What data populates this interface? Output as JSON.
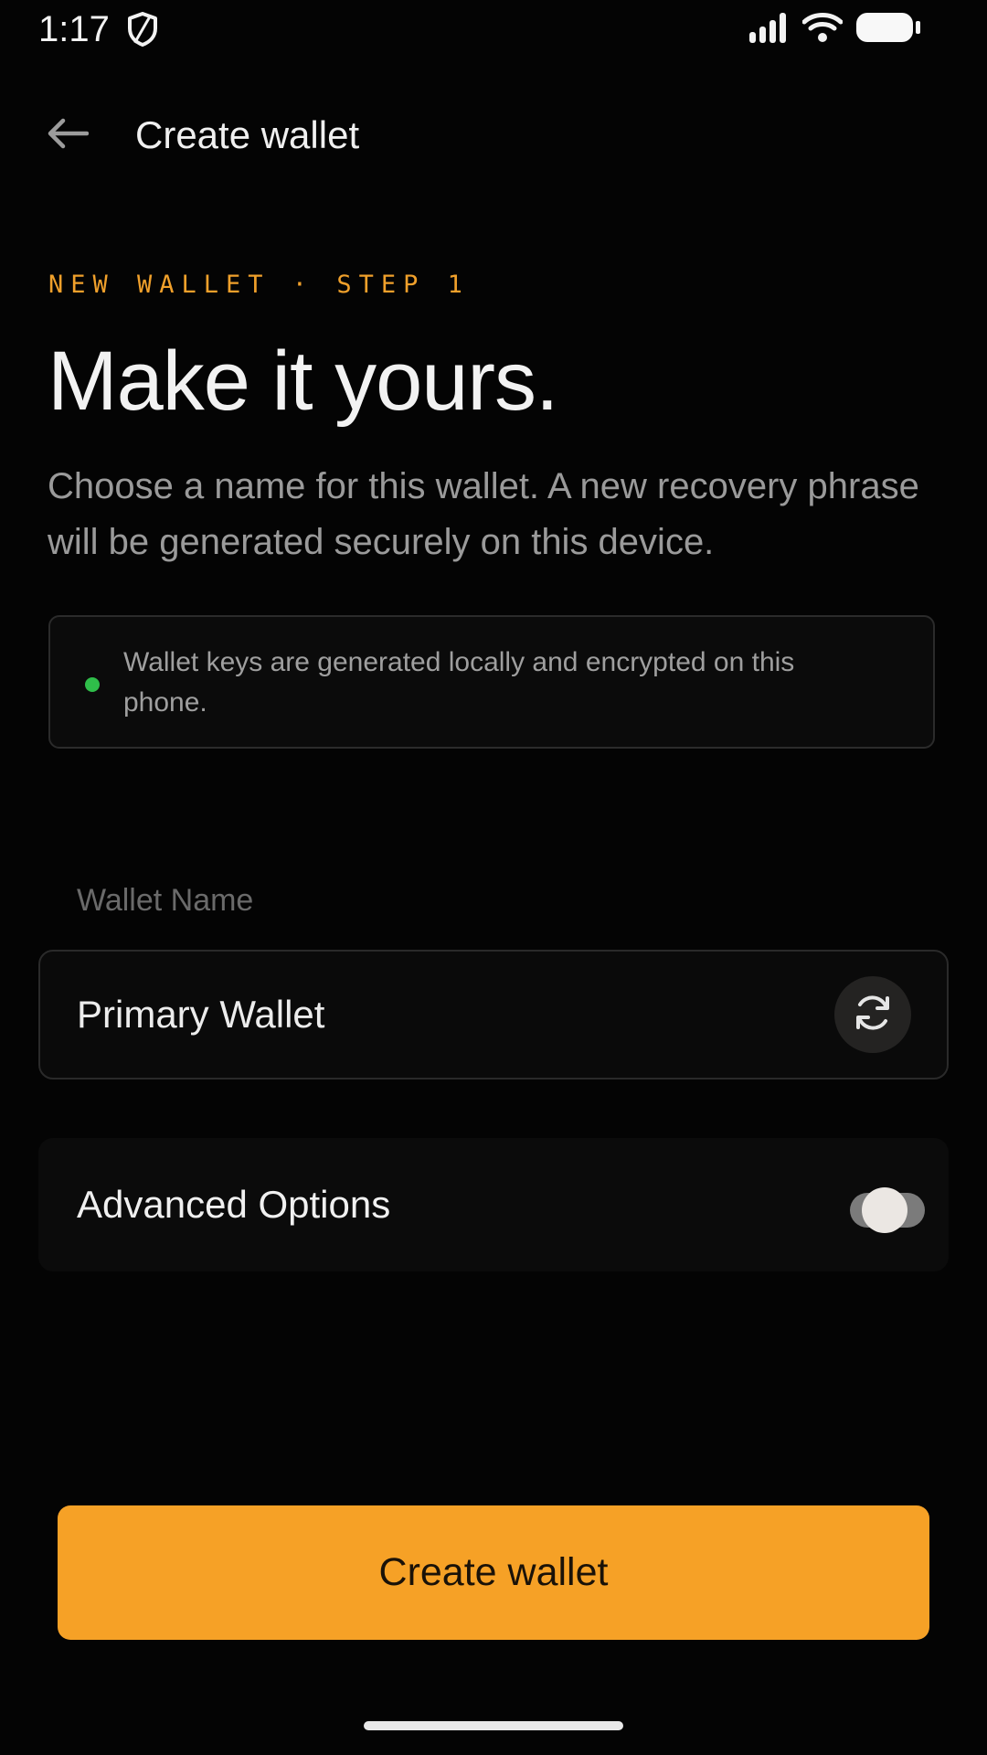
{
  "status_bar": {
    "time": "1:17",
    "icons": [
      "shield-icon",
      "signal-icon",
      "wifi-icon",
      "battery-icon"
    ]
  },
  "app_bar": {
    "back_icon": "arrow-left-icon",
    "title": "Create wallet"
  },
  "intro": {
    "eyebrow": "NEW WALLET · STEP 1",
    "headline": "Make it yours.",
    "subtext": "Choose a name for this wallet. A new recovery phrase will be generated securely on this device."
  },
  "notice": {
    "text": "Wallet keys are generated locally and encrypted on this phone.",
    "dot_color": "#2fbe4a"
  },
  "wallet_name": {
    "label": "Wallet Name",
    "value": "Primary Wallet",
    "regenerate_icon": "refresh-icon"
  },
  "advanced": {
    "label": "Advanced Options",
    "enabled": false
  },
  "primary_action": {
    "label": "Create wallet"
  },
  "colors": {
    "accent": "#f6a126",
    "eyebrow": "#f0a02b",
    "background": "#040404"
  }
}
